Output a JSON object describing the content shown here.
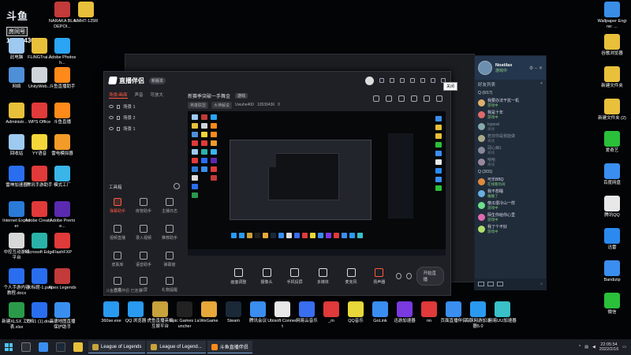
{
  "room": {
    "brand": "斗鱼",
    "label": "房间号",
    "number": "10539436"
  },
  "desktop_left": [
    {
      "label": "此电脑",
      "color": "#9ec9f0"
    },
    {
      "label": "FLiNGTrai...",
      "color": "#e8c03a"
    },
    {
      "label": "Adobe Photosh...",
      "color": "#2aa4f4"
    },
    {
      "label": "网络",
      "color": "#4f8fd8"
    },
    {
      "label": "UnityWeb...",
      "color": "#cfd4da"
    },
    {
      "label": "斗鱼直播助手",
      "color": "#ff8a1a"
    },
    {
      "label": "Administr...",
      "color": "#e8c03a"
    },
    {
      "label": "WPS Office",
      "color": "#e03a3a"
    },
    {
      "label": "斗鱼直播",
      "color": "#ff8a1a"
    },
    {
      "label": "回收站",
      "color": "#9ec9f0"
    },
    {
      "label": "YY语音",
      "color": "#f5d63a"
    },
    {
      "label": "雷电模拟器",
      "color": "#f29b28"
    },
    {
      "label": "雷神加速器",
      "color": "#2a6ef0"
    },
    {
      "label": "腾讯手游助手",
      "color": "#e03a3a"
    },
    {
      "label": "模式工厂",
      "color": "#3ab5ea"
    },
    {
      "label": "Internet Explorer",
      "color": "#2a7ad8"
    },
    {
      "label": "Adobe Creati...",
      "color": "#e03a3a"
    },
    {
      "label": "Adobe Premie...",
      "color": "#5a2ab0"
    },
    {
      "label": "中控互动游戏平台",
      "color": "#d8d8d8"
    },
    {
      "label": "Microsoft Edge",
      "color": "#2ab1a8"
    },
    {
      "label": "FlashFXP",
      "color": "#e03a3a"
    },
    {
      "label": "个人手游内容教程.docx",
      "color": "#2a6ef0"
    },
    {
      "label": "未标题-1.psd",
      "color": "#2a6ef0"
    },
    {
      "label": "Apex Legends",
      "color": "#c23a3a"
    },
    {
      "label": "新建XLSX 工作表.xlsx",
      "color": "#2a9a4a"
    },
    {
      "label": "文档1 (1).docx",
      "color": "#2a6ef0"
    },
    {
      "label": "高德地图直播保护助手",
      "color": "#3a8ef0"
    }
  ],
  "desktop_top": [
    {
      "label": "NARAKA BLADEPOI...",
      "color": "#c23a3a"
    },
    {
      "label": "NMHT-125R",
      "color": "#e8c03a"
    }
  ],
  "desktop_right": [
    {
      "label": "Wallpaper Engine: ...",
      "color": "#3a8ee8"
    },
    {
      "label": "谷歌浏览器",
      "color": "#e8c03a"
    },
    {
      "label": "新建文件夹",
      "color": "#e8c03a"
    },
    {
      "label": "新建文件夹 (2)",
      "color": "#e8c03a"
    },
    {
      "label": "爱奇艺",
      "color": "#2ac03a"
    },
    {
      "label": "百度网盘",
      "color": "#3a8ef0"
    },
    {
      "label": "腾讯QQ",
      "color": "#e8e8e8"
    },
    {
      "label": "迅雷",
      "color": "#2a8af0"
    },
    {
      "label": "Bandizip",
      "color": "#3a8ef0"
    },
    {
      "label": "微信",
      "color": "#2ac03a"
    }
  ],
  "desktop_bottom": [
    {
      "label": "360se.exe",
      "color": "#2a9af0"
    },
    {
      "label": "QQ 浏览器",
      "color": "#2a9af0"
    },
    {
      "label": "虎鱼直播英雄互娱平台",
      "color": "#c8a23a"
    },
    {
      "label": "Epic Games Launcher",
      "color": "#222"
    },
    {
      "label": "WeGame",
      "color": "#e8a83a"
    },
    {
      "label": "Steam",
      "color": "#1b2838"
    },
    {
      "label": "腾讯会议",
      "color": "#3a8ef0"
    },
    {
      "label": "Ubisoft Connect",
      "color": "#e8e8e8"
    },
    {
      "label": "网易云音乐",
      "color": "#3a6ef0"
    },
    {
      "label": "_m",
      "color": "#e03a3a"
    },
    {
      "label": "QQ音乐",
      "color": "#e8d83a"
    },
    {
      "label": "GoLink",
      "color": "#3a8ef0"
    },
    {
      "label": "迅游加速器",
      "color": "#7a3ae0"
    },
    {
      "label": "nn",
      "color": "#e03a3a"
    },
    {
      "label": "页面直播伴侣",
      "color": "#3a8ef0"
    },
    {
      "label": "海豚网游加速器5.0",
      "color": "#2a9af0"
    },
    {
      "label": "网易UU加速器",
      "color": "#3ac0c8"
    }
  ],
  "app": {
    "title": "直播伴侣",
    "version_badge": "新版本",
    "tabs": [
      "场景/画面",
      "声音",
      "可放大"
    ],
    "scenes": [
      "场景 1",
      "场景 2",
      "场景 1"
    ],
    "tools_title": "工具箱",
    "tools": [
      "弹幕助手",
      "房管助手",
      "主播日志",
      "视频直播",
      "录入视频",
      "推荐助手",
      "皮肤库",
      "语音助手",
      "弹幕窗",
      "连麦",
      "公屏",
      "礼物提醒"
    ],
    "room_title": "新赛季突破一手舞金",
    "room_tag": "游戏",
    "meta_chips": [
      "英雄联盟",
      "大神解说"
    ],
    "meta_uid": "Uwuhe400",
    "meta_room": "10539436",
    "meta_fans": "0",
    "bottom_buttons": [
      "画面调整",
      "摄像头",
      "手机投屏",
      "多媒体",
      "麦克风",
      "扬声器"
    ],
    "live_button": "开始直播",
    "status": "斗鱼直播伴侣 已连接",
    "tooltip": "关闭"
  },
  "friends": {
    "name": "Nostilax",
    "status": "游戏中",
    "subtitle": "好友列表",
    "group1": "Q (6/17)",
    "items1": [
      {
        "name": "我要办法干扰一机",
        "status": "游戏中",
        "color": "#e0b06a",
        "off": false
      },
      {
        "name": "我是十年",
        "status": "游戏中",
        "color": "#e06a6a",
        "off": false
      },
      {
        "name": "bypeat",
        "status": "离线",
        "color": "#8aa",
        "off": true
      },
      {
        "name": "若非你是我能做",
        "status": "离线",
        "color": "#aa8",
        "off": true
      },
      {
        "name": "冠心病1",
        "status": "离线",
        "color": "#889",
        "off": true
      },
      {
        "name": "哈哈",
        "status": "离线",
        "color": "#989",
        "off": true
      }
    ],
    "group2": "Q (3/31)",
    "items2": [
      {
        "name": "可乐BBQ",
        "status": "在线看热闹",
        "color": "#e08a3a",
        "off": false
      },
      {
        "name": "我不想睡",
        "status": "蛐蛐了",
        "color": "#6ab0e0",
        "off": false
      },
      {
        "name": "傻瓜很冷山一样",
        "status": "游戏中",
        "color": "#6ae08a",
        "off": false
      },
      {
        "name": "陌生你给你心里",
        "status": "游戏中",
        "color": "#e06ab0",
        "off": false
      },
      {
        "name": "我了个不好",
        "status": "游戏中",
        "color": "#b0e06a",
        "off": false
      }
    ]
  },
  "taskbar": {
    "tasks": [
      "League of Legends",
      "League of Legend...",
      "斗鱼直播伴侣"
    ],
    "time": "22:05:54",
    "date": "2022/2/16"
  }
}
